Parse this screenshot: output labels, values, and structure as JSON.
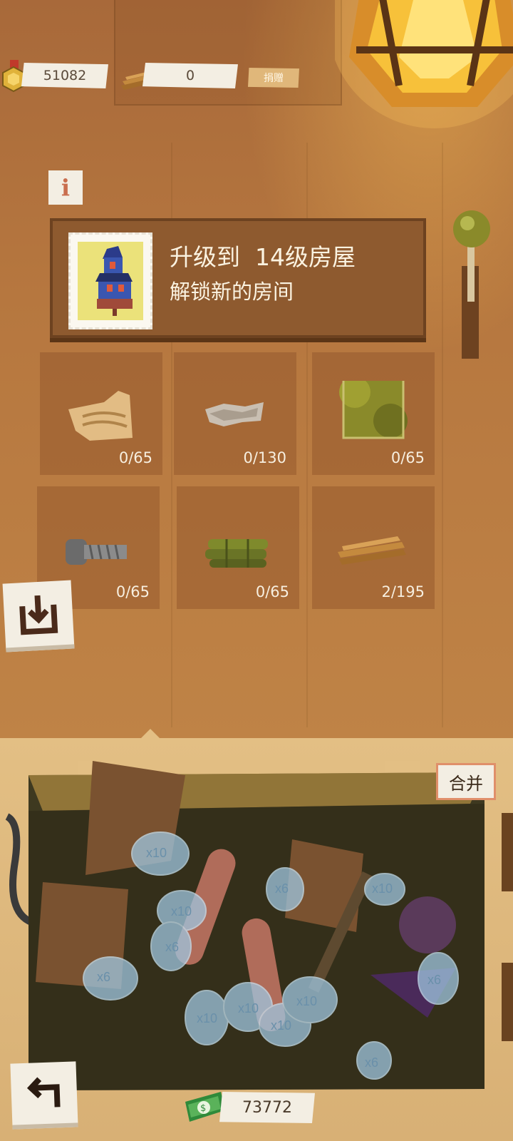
{
  "top_bar": {
    "coins": "51082",
    "wood": "0",
    "donate_label": "捐赠"
  },
  "upgrade": {
    "title": "升级到  14级房屋",
    "subtitle": "解锁新的房间"
  },
  "materials": [
    {
      "name": "wood-trim",
      "count": "0/65"
    },
    {
      "name": "fabric",
      "count": "0/130"
    },
    {
      "name": "wallpaper",
      "count": "0/65"
    },
    {
      "name": "bolt",
      "count": "0/65"
    },
    {
      "name": "bamboo",
      "count": "0/65"
    },
    {
      "name": "planks",
      "count": "2/195"
    }
  ],
  "crate": {
    "merge_label": "合并",
    "multipliers": [
      "x10",
      "x10",
      "x6",
      "x6",
      "x10",
      "x10",
      "x10",
      "x10",
      "x6",
      "x10",
      "x6",
      "x6"
    ]
  },
  "bottom": {
    "money": "73772"
  },
  "colors": {
    "wall": "#b5773f",
    "board": "#8e5a2f",
    "shelf": "#e3bf84",
    "paper": "#f3eee3"
  }
}
